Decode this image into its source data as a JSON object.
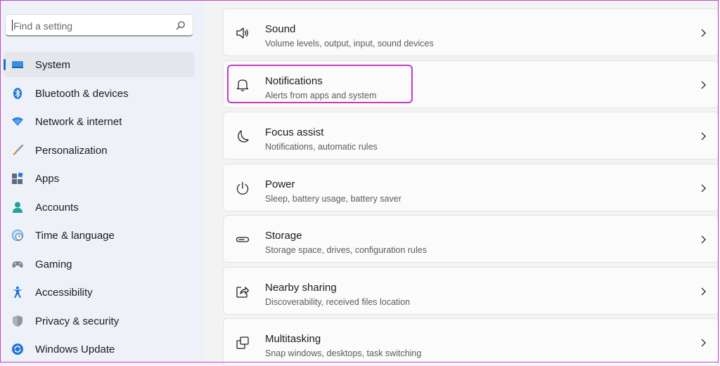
{
  "search": {
    "placeholder": "Find a setting",
    "icon": "search-icon"
  },
  "sidebar": {
    "accent": "#1a6fc9",
    "items": [
      {
        "label": "System",
        "icon": "system-icon",
        "active": true
      },
      {
        "label": "Bluetooth & devices",
        "icon": "bluetooth-icon"
      },
      {
        "label": "Network & internet",
        "icon": "wifi-icon"
      },
      {
        "label": "Personalization",
        "icon": "brush-icon"
      },
      {
        "label": "Apps",
        "icon": "apps-icon"
      },
      {
        "label": "Accounts",
        "icon": "account-icon"
      },
      {
        "label": "Time & language",
        "icon": "globe-clock-icon"
      },
      {
        "label": "Gaming",
        "icon": "gamepad-icon"
      },
      {
        "label": "Accessibility",
        "icon": "accessibility-icon"
      },
      {
        "label": "Privacy & security",
        "icon": "shield-icon"
      },
      {
        "label": "Windows Update",
        "icon": "update-icon"
      }
    ]
  },
  "main": {
    "highlight_color": "#c13bc6",
    "cards": [
      {
        "title": "Sound",
        "subtitle": "Volume levels, output, input, sound devices",
        "icon": "speaker-icon"
      },
      {
        "title": "Notifications",
        "subtitle": "Alerts from apps and system",
        "icon": "bell-icon",
        "highlighted": true
      },
      {
        "title": "Focus assist",
        "subtitle": "Notifications, automatic rules",
        "icon": "moon-icon"
      },
      {
        "title": "Power",
        "subtitle": "Sleep, battery usage, battery saver",
        "icon": "power-icon"
      },
      {
        "title": "Storage",
        "subtitle": "Storage space, drives, configuration rules",
        "icon": "storage-icon"
      },
      {
        "title": "Nearby sharing",
        "subtitle": "Discoverability, received files location",
        "icon": "share-icon"
      },
      {
        "title": "Multitasking",
        "subtitle": "Snap windows, desktops, task switching",
        "icon": "multitasking-icon"
      }
    ]
  }
}
